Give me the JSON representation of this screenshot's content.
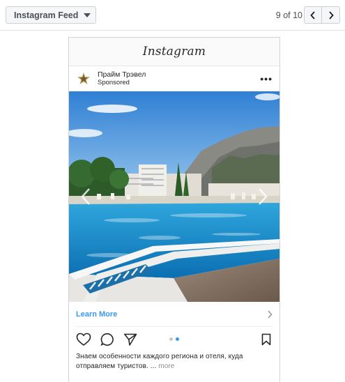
{
  "toolbar": {
    "feed_select_label": "Instagram Feed",
    "pager_text": "9 of 10"
  },
  "instagram": {
    "logo_text": "Instagram",
    "account_name": "Прайм Трэвел",
    "account_subtitle": "Sponsored",
    "cta_label": "Learn More",
    "caption_text": "Знаем особенности каждого региона и отеля, куда отправляем туристов. ...",
    "caption_more": "more",
    "carousel": {
      "slide_count": 2,
      "active_index": 1
    }
  },
  "colors": {
    "cta_blue": "#3897f0",
    "toolbar_bg": "#f5f6f7",
    "border": "#ccd0d5"
  }
}
